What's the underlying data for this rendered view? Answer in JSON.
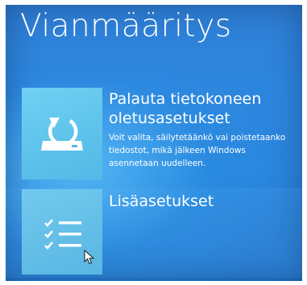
{
  "screen": {
    "title": "Vianmääritys"
  },
  "options": [
    {
      "title": "Palauta tietokoneen oletusasetukset",
      "description": "Voit valita, säilytetäänkö vai poistetaanko tiedostot, mikä jälkeen Windows asennetaan uudelleen.",
      "icon": "reset-pc-icon"
    },
    {
      "title": "Lisäasetukset",
      "icon": "checklist-icon"
    }
  ],
  "colors": {
    "background": "#2a86dd",
    "tile": "#5cc0ea",
    "text": "#ffffff"
  },
  "cursor": {
    "icon": "mouse-pointer-icon"
  }
}
